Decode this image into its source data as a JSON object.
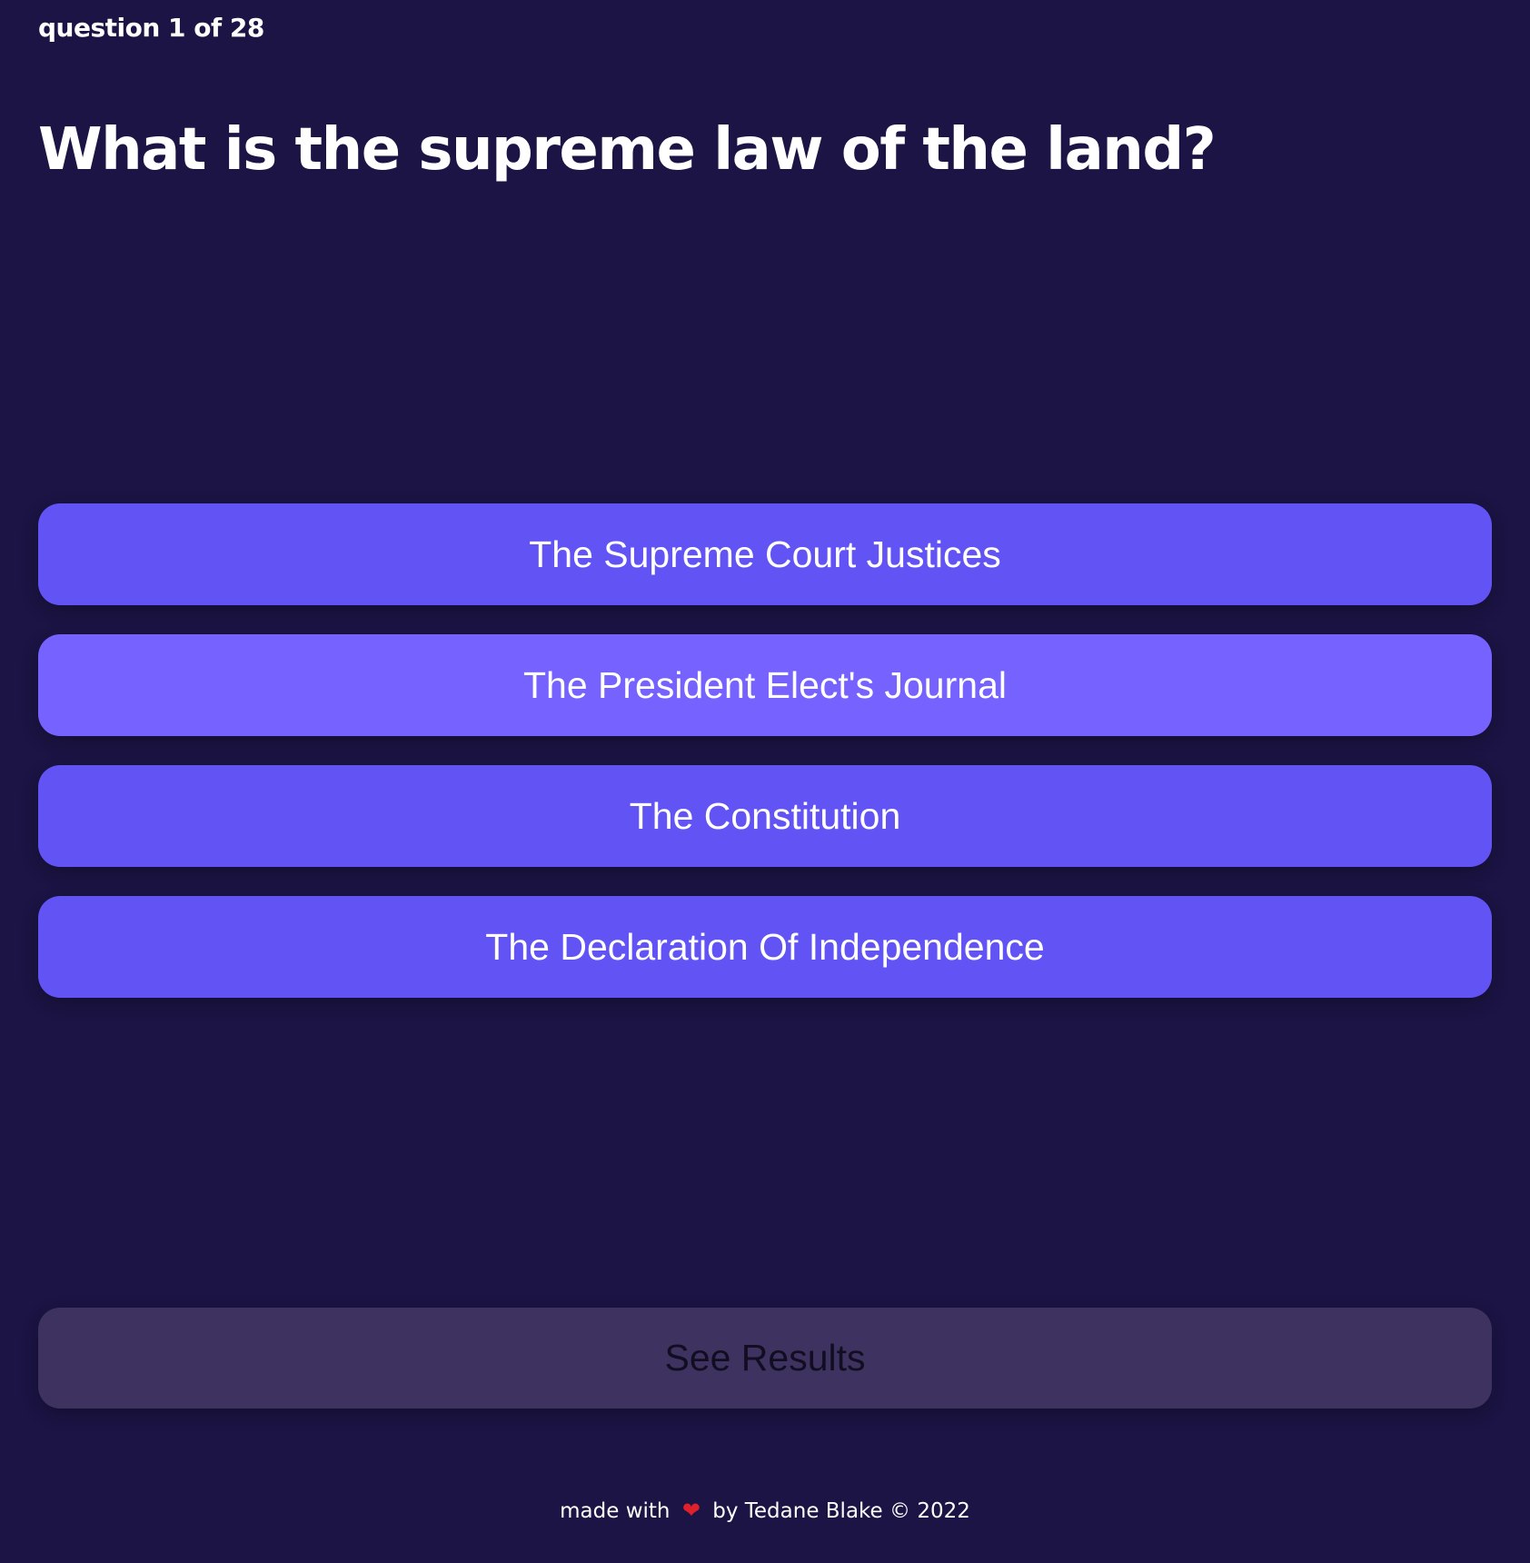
{
  "quiz": {
    "progress_label": "question 1 of 28",
    "question": "What is the supreme law of the land?",
    "answers": [
      "The Supreme Court Justices",
      "The President Elect's Journal",
      "The Constitution",
      "The Declaration Of Independence"
    ],
    "results_label": "See Results"
  },
  "footer": {
    "text_before": "made with",
    "icon": "heart-icon",
    "text_after": "by Tedane Blake © 2022"
  },
  "colors": {
    "background": "#1b1444",
    "answer_button": "#6153f4",
    "answer_button_hover": "#7562ff",
    "results_button": "#3e3360",
    "heart": "#e0202a"
  }
}
